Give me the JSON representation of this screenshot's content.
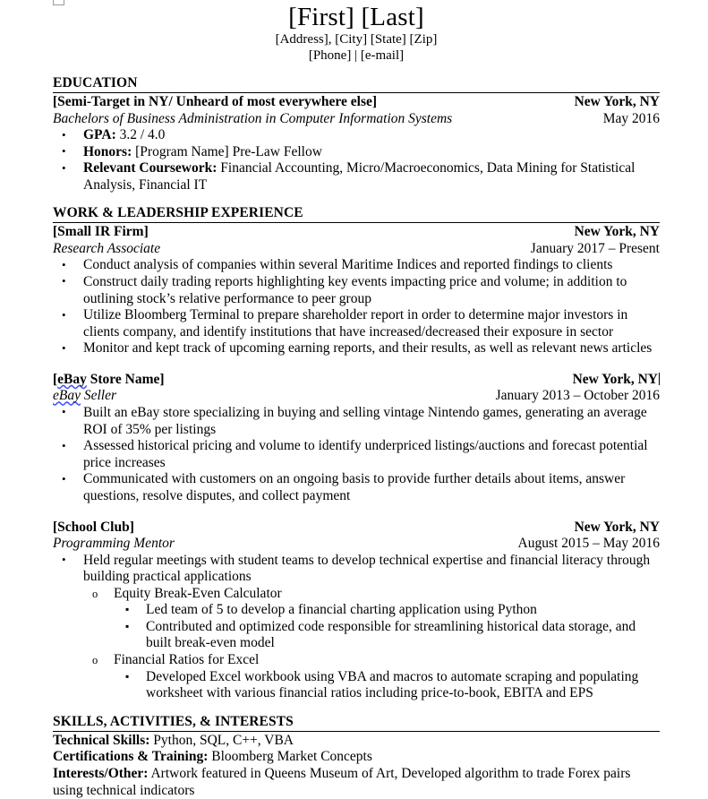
{
  "document": {
    "title_first": "[First]",
    "title_last": "[Last]",
    "title_full": "[First] [Last]",
    "contact_line1": "[Address], [City] [State] [Zip]",
    "contact_line2": "[Phone] | [e-mail]"
  },
  "sections": {
    "education": {
      "heading": "EDUCATION",
      "entry": {
        "org": "[Semi-Target in NY/ Unheard of most everywhere else]",
        "location": "New York, NY",
        "role": "Bachelors of Business Administration in Computer Information Systems",
        "dates": "May 2016"
      },
      "bullets": [
        {
          "label": "GPA:",
          "text": " 3.2 / 4.0"
        },
        {
          "label": "Honors:",
          "text": " [Program Name] Pre-Law Fellow"
        },
        {
          "label": "Relevant Coursework:",
          "text": " Financial Accounting, Micro/Macroeconomics, Data Mining for Statistical Analysis, Financial IT"
        }
      ]
    },
    "work": {
      "heading": "WORK & LEADERSHIP EXPERIENCE",
      "entries": [
        {
          "org": "[Small IR Firm]",
          "location": "New York, NY",
          "role": "Research Associate",
          "dates": "January 2017 – Present",
          "bullets": [
            "Conduct analysis of companies within several Maritime Indices and reported findings to clients",
            "Construct daily trading reports highlighting key events impacting price and volume; in addition to outlining stock’s relative performance to peer group",
            "Utilize Bloomberg Terminal to prepare shareholder report in order to determine major investors in clients company, and identify institutions that have increased/decreased their exposure in sector",
            "Monitor and kept track of upcoming earning reports, and their results, as well as relevant news articles"
          ]
        },
        {
          "org_spell": "eBay",
          "org_rest": " Store Name]",
          "org_prefix": "[",
          "org": "[eBay Store Name]",
          "location": "New York, NY",
          "role_spell": "eBay",
          "role_rest": " Seller",
          "role": "eBay Seller",
          "dates": "January 2013 – October 2016",
          "bullets": [
            "Built an eBay store specializing in buying and selling vintage Nintendo games, generating an average ROI of 35% per listings",
            "Assessed historical pricing and volume to identify underpriced listings/auctions and forecast potential price increases",
            "Communicated with customers on an ongoing basis to provide further details about items, answer questions, resolve disputes, and collect payment"
          ]
        },
        {
          "org": "[School Club]",
          "location": "New York, NY",
          "role": "Programming Mentor",
          "dates": "August 2015 – May 2016",
          "bullets": [
            "Held regular meetings with student teams to develop technical expertise and financial literacy through building practical applications"
          ],
          "sub_groups": [
            {
              "title": "Equity Break-Even Calculator",
              "items": [
                "Led team of 5 to develop a financial charting application using Python",
                "Contributed and optimized code responsible for streamlining historical data storage, and built break-even model"
              ]
            },
            {
              "title": "Financial Ratios for Excel",
              "items": [
                "Developed Excel workbook using VBA and macros to automate scraping and populating worksheet with various financial ratios including price-to-book, EBITA and EPS"
              ]
            }
          ]
        }
      ]
    },
    "skills": {
      "heading": "SKILLS, ACTIVITIES, & INTERESTS",
      "lines": [
        {
          "label": "Technical Skills:",
          "text": " Python, SQL, C++, VBA"
        },
        {
          "label": "Certifications & Training:",
          "text": " Bloomberg Market Concepts"
        },
        {
          "label": "Interests/Other:",
          "text": " Artwork featured in Queens Museum of Art, Developed algorithm to trade Forex pairs using technical indicators"
        }
      ]
    }
  },
  "colors": {
    "text": "#000000",
    "background": "#ffffff",
    "rule": "#000000",
    "spellcheck_underline": "#3f51ff",
    "margin_mark": "#9a9a9a"
  }
}
